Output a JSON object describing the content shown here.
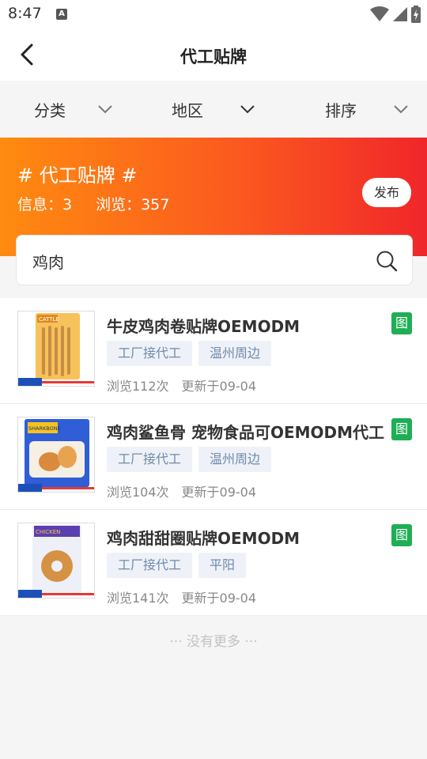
{
  "status": {
    "time": "8:47",
    "notif_letter": "A"
  },
  "nav": {
    "title": "代工贴牌"
  },
  "filters": [
    {
      "label": "分类"
    },
    {
      "label": "地区"
    },
    {
      "label": "排序"
    }
  ],
  "banner": {
    "title": "# 代工贴牌 #",
    "info": "信息：3",
    "views": "浏览：357",
    "publish_label": "发布"
  },
  "search": {
    "value": "鸡肉"
  },
  "items": [
    {
      "title": "牛皮鸡肉卷贴牌OEMODM",
      "tags": [
        "工厂接代工",
        "温州周边"
      ],
      "views": "浏览112次",
      "updated": "更新于09-04",
      "badge": "图",
      "thumb_label": "CATTLE",
      "thumb_color": "#f2a531"
    },
    {
      "title": "鸡肉鲨鱼骨 宠物食品可OEMODM代工",
      "tags": [
        "工厂接代工",
        "温州周边"
      ],
      "views": "浏览104次",
      "updated": "更新于09-04",
      "badge": "图",
      "thumb_label": "SHARKBONE",
      "thumb_color": "#2b56c9"
    },
    {
      "title": "鸡肉甜甜圈贴牌OEMODM",
      "tags": [
        "工厂接代工",
        "平阳"
      ],
      "views": "浏览141次",
      "updated": "更新于09-04",
      "badge": "图",
      "thumb_label": "CHICKEN",
      "thumb_color": "#5b3fb0"
    }
  ],
  "footer": {
    "no_more": "··· 没有更多 ···"
  },
  "colors": {
    "badge_green": "#1eae55",
    "banner_start": "#ff8b10",
    "banner_end": "#f0262a"
  }
}
